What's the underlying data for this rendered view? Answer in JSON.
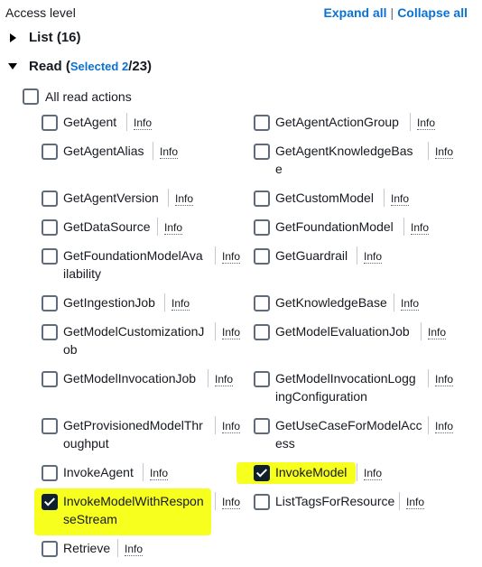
{
  "header": {
    "title": "Access level",
    "expand_all": "Expand all",
    "separator": "|",
    "collapse_all": "Collapse all"
  },
  "list_section": {
    "label": "List",
    "count": "(16)"
  },
  "read_section": {
    "label": "Read",
    "open_paren": "(",
    "selected_text": "Selected 2",
    "total": "/23)"
  },
  "all_read_actions": {
    "label": "All read actions",
    "checked": false
  },
  "info_label": "Info",
  "actions": {
    "get_agent": {
      "label": "GetAgent",
      "checked": false
    },
    "get_agent_action_group": {
      "label": "GetAgentActionGroup",
      "checked": false
    },
    "get_agent_alias": {
      "label": "GetAgentAlias",
      "checked": false
    },
    "get_agent_knowledge_base": {
      "line1": "GetAgentKnowledgeBas",
      "line2": "e",
      "checked": false
    },
    "get_agent_version": {
      "label": "GetAgentVersion",
      "checked": false
    },
    "get_custom_model": {
      "label": "GetCustomModel",
      "checked": false
    },
    "get_data_source": {
      "label": "GetDataSource",
      "checked": false
    },
    "get_foundation_model": {
      "label": "GetFoundationModel",
      "checked": false
    },
    "get_foundation_model_availability": {
      "line1": "GetFoundationModelAva",
      "line2": "ilability",
      "checked": false
    },
    "get_guardrail": {
      "label": "GetGuardrail",
      "checked": false
    },
    "get_ingestion_job": {
      "label": "GetIngestionJob",
      "checked": false
    },
    "get_knowledge_base": {
      "label": "GetKnowledgeBase",
      "checked": false
    },
    "get_model_customization_job": {
      "line1": "GetModelCustomizationJ",
      "line2": "ob",
      "checked": false
    },
    "get_model_evaluation_job": {
      "label": "GetModelEvaluationJob",
      "checked": false
    },
    "get_model_invocation_job": {
      "label": "GetModelInvocationJob",
      "checked": false
    },
    "get_model_invocation_logging_configuration": {
      "line1": "GetModelInvocationLogg",
      "line2": "ingConfiguration",
      "checked": false
    },
    "get_provisioned_model_throughput": {
      "line1": "GetProvisionedModelThr",
      "line2": "oughput",
      "checked": false
    },
    "get_use_case_for_model_access": {
      "line1": "GetUseCaseForModelAcc",
      "line2": "ess",
      "checked": false
    },
    "invoke_agent": {
      "label": "InvokeAgent",
      "checked": false
    },
    "invoke_model": {
      "label": "InvokeModel",
      "checked": true
    },
    "invoke_model_with_response_stream": {
      "line1": "InvokeModelWithRespon",
      "line2": "seStream",
      "checked": true
    },
    "list_tags_for_resource": {
      "label": "ListTagsForResource",
      "checked": false
    },
    "retrieve": {
      "label": "Retrieve",
      "checked": false
    }
  },
  "highlight_color": "#f7ff1f",
  "accent_color": "#0972d3"
}
